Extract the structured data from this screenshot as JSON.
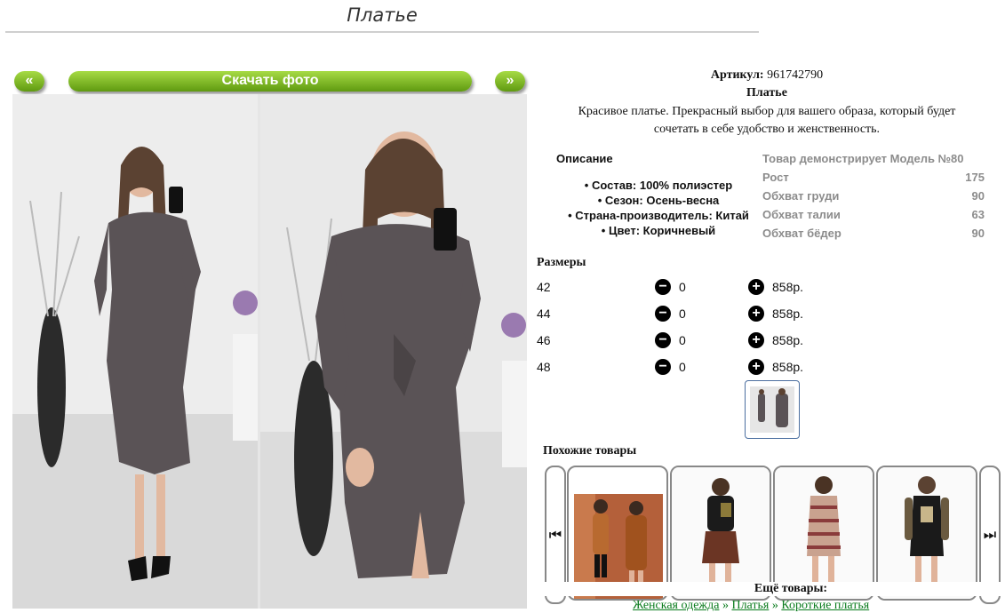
{
  "page": {
    "title": "Платье"
  },
  "gallery": {
    "prev_label": "«",
    "download_label": "Скачать фото",
    "next_label": "»"
  },
  "product": {
    "article_label": "Артикул:",
    "article_value": "961742790",
    "name": "Платье",
    "description_line1": "Красивое платье. Прекрасный выбор для вашего образа, который будет",
    "description_line2": "сочетать в себе удобство и женственность."
  },
  "description": {
    "heading": "Описание",
    "items": [
      "Состав: 100% полиэстер",
      "Сезон: Осень-весна",
      "Страна-производитель: Китай",
      "Цвет: Коричневый"
    ]
  },
  "model": {
    "heading": "Товар демонстрирует Модель №80",
    "rows": [
      {
        "label": "Рост",
        "value": "175"
      },
      {
        "label": "Обхват груди",
        "value": "90"
      },
      {
        "label": "Обхват талии",
        "value": "63"
      },
      {
        "label": "Обхват бёдер",
        "value": "90"
      }
    ]
  },
  "sizes": {
    "heading": "Размеры",
    "minus_icon": "⊖",
    "plus_icon": "⊕",
    "rows": [
      {
        "size": "42",
        "qty": "0",
        "price": "858р."
      },
      {
        "size": "44",
        "qty": "0",
        "price": "858р."
      },
      {
        "size": "46",
        "qty": "0",
        "price": "858р."
      },
      {
        "size": "48",
        "qty": "0",
        "price": "858р."
      }
    ]
  },
  "similar": {
    "heading": "Похожие товары",
    "prev_icon": "⏮",
    "next_icon": "⏭"
  },
  "more": {
    "heading": "Ещё товары:",
    "crumbs": [
      "Женская одежда",
      "Платья",
      "Короткие платья"
    ],
    "separator": "»"
  },
  "colors": {
    "accent_green": "#6aa61a",
    "link_green": "#0b7c1e",
    "model_gray": "#8c8c8c",
    "dress_gray": "#5a5356"
  }
}
